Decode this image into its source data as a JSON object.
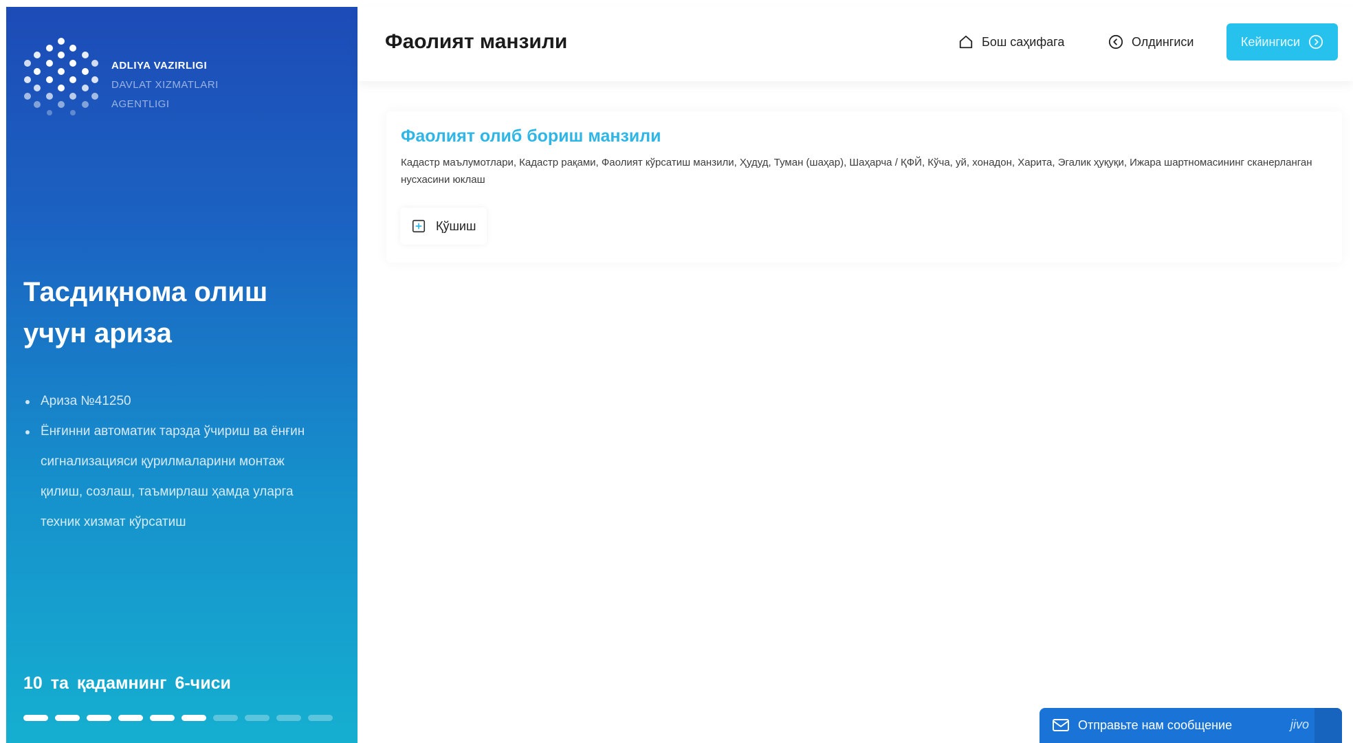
{
  "sidebar": {
    "logo": {
      "line1": "ADLIYA VAZIRLIGI",
      "line2": "DAVLAT XIZMATLARI",
      "line3": "AGENTLIGI"
    },
    "title": "Тасдиқнома олиш учун ариза",
    "info": [
      "Ариза №41250",
      "Ёнғинни автоматик тарзда ўчириш ва ёнғин сигнализацияси қурилмаларини монтаж қилиш, созлаш, таъмирлаш ҳамда уларга техник хизмат кўрсатиш"
    ],
    "step_text": "10 та қадамнинг 6-чиси",
    "steps_total": 10,
    "steps_done": 6
  },
  "header": {
    "title": "Фаолият манзили",
    "home_label": "Бош саҳифага",
    "prev_label": "Олдингиси",
    "next_label": "Кейингиси"
  },
  "card": {
    "title": "Фаолият олиб бориш манзили",
    "description": "Кадастр маълумотлари, Кадастр рақами, Фаолият кўрсатиш манзили, Ҳудуд, Туман (шаҳар), Шаҳарча / ҚФЙ, Кўча, уй, хонадон, Харита, Эгалик ҳуқуқи, Ижара шартномасининг сканерланган нусхасини юклаш",
    "add_label": "Қўшиш"
  },
  "chat": {
    "label": "Отправьте нам сообщение",
    "brand": "jivo"
  },
  "colors": {
    "accent": "#27c1ee",
    "title_blue": "#2fb6e6",
    "sidebar_top": "#1d4bb7",
    "sidebar_bottom": "#15afd0",
    "chat": "#1a73d6"
  },
  "icons": {
    "home": "home-icon",
    "prev": "arrow-left-circle-icon",
    "next": "arrow-right-circle-icon",
    "add": "plus-square-icon",
    "chat": "message-icon"
  }
}
